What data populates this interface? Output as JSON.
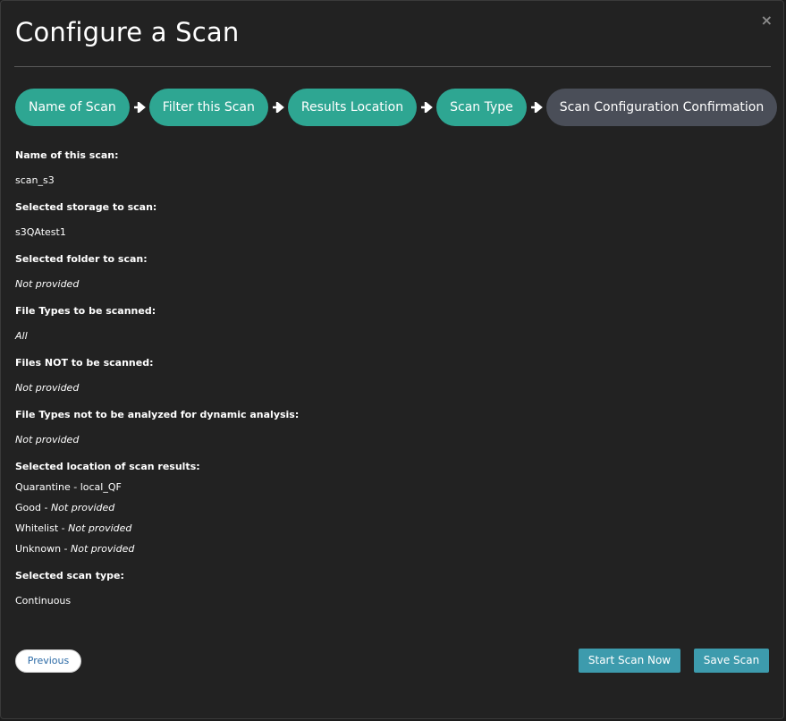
{
  "dialog": {
    "title": "Configure a Scan",
    "close_glyph": "×"
  },
  "steps": [
    {
      "label": "Name of Scan",
      "current": false
    },
    {
      "label": "Filter this Scan",
      "current": false
    },
    {
      "label": "Results Location",
      "current": false
    },
    {
      "label": "Scan Type",
      "current": false
    },
    {
      "label": "Scan Configuration Confirmation",
      "current": true
    }
  ],
  "summary": {
    "name_label": "Name of this scan:",
    "name_value": "scan_s3",
    "storage_label": "Selected storage to scan:",
    "storage_value": "s3QAtest1",
    "folder_label": "Selected folder to scan:",
    "folder_value": "Not provided",
    "filetypes_label": "File Types to be scanned:",
    "filetypes_value": "All",
    "excluded_label": "Files NOT to be scanned:",
    "excluded_value": "Not provided",
    "dynamic_label": "File Types not to be analyzed for dynamic analysis:",
    "dynamic_value": "Not provided",
    "results_label": "Selected location of scan results:",
    "results": [
      {
        "name": "Quarantine - ",
        "value": "local_QF",
        "italic": false
      },
      {
        "name": "Good - ",
        "value": "Not provided",
        "italic": true
      },
      {
        "name": "Whitelist - ",
        "value": "Not provided",
        "italic": true
      },
      {
        "name": "Unknown - ",
        "value": "Not provided",
        "italic": true
      }
    ],
    "type_label": "Selected scan type:",
    "type_value": "Continuous"
  },
  "footer": {
    "previous_label": "Previous",
    "start_label": "Start Scan Now",
    "save_label": "Save Scan"
  },
  "colors": {
    "step_done": "#2ea692",
    "step_current": "#4a4e58",
    "primary_button": "#3d9bad",
    "background": "#222222"
  }
}
